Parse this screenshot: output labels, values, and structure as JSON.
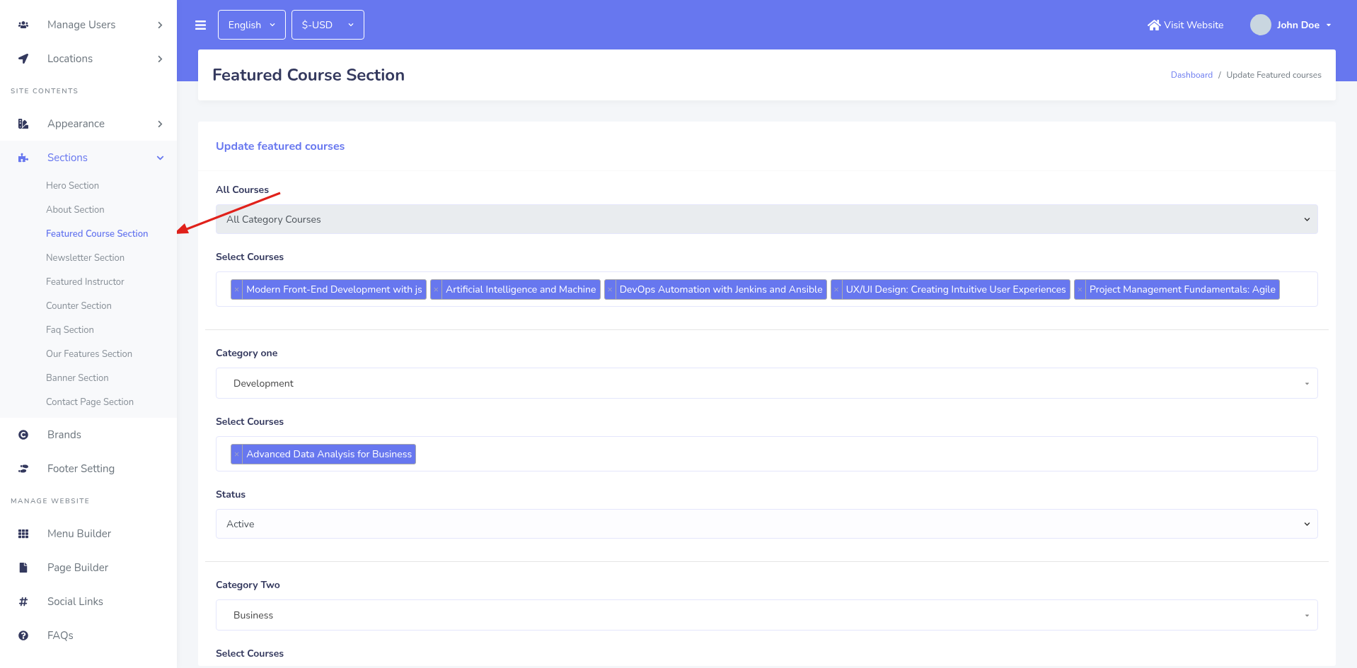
{
  "sidebar": {
    "items": [
      {
        "kind": "item",
        "label": "Manage Users",
        "expanded": false,
        "selected": false
      },
      {
        "kind": "item",
        "label": "Locations",
        "expanded": false,
        "selected": false
      },
      {
        "kind": "heading",
        "label": "SITE CONTENTS"
      },
      {
        "kind": "item",
        "label": "Appearance",
        "expanded": false,
        "selected": false
      },
      {
        "kind": "item",
        "label": "Sections",
        "expanded": true,
        "selected": true,
        "children": [
          {
            "label": "Hero Section",
            "selected": false
          },
          {
            "label": "About Section",
            "selected": false
          },
          {
            "label": "Featured Course Section",
            "selected": true
          },
          {
            "label": "Newsletter Section",
            "selected": false
          },
          {
            "label": "Featured Instructor",
            "selected": false
          },
          {
            "label": "Counter Section",
            "selected": false
          },
          {
            "label": "Faq Section",
            "selected": false
          },
          {
            "label": "Our Features Section",
            "selected": false
          },
          {
            "label": "Banner Section",
            "selected": false
          },
          {
            "label": "Contact Page Section",
            "selected": false
          }
        ]
      },
      {
        "kind": "item",
        "label": "Brands",
        "selected": false
      },
      {
        "kind": "item",
        "label": "Footer Setting",
        "selected": false
      },
      {
        "kind": "heading",
        "label": "MANAGE WEBSITE"
      },
      {
        "kind": "item",
        "label": "Menu Builder",
        "selected": false
      },
      {
        "kind": "item",
        "label": "Page Builder",
        "selected": false
      },
      {
        "kind": "item",
        "label": "Social Links",
        "selected": false
      },
      {
        "kind": "item",
        "label": "FAQs",
        "selected": false
      }
    ]
  },
  "topbar": {
    "language": "English",
    "currency": "$-USD",
    "visit_link": "Visit Website",
    "user": "John Doe"
  },
  "header": {
    "title": "Featured Course Section",
    "breadcrumb": [
      {
        "label": "Dashboard"
      },
      {
        "separator": "/",
        "label": "Update Featured courses"
      }
    ]
  },
  "form": {
    "title": "Update featured courses",
    "groups": [
      [
        {
          "kind": "select",
          "label": "All Courses",
          "value": "All Category Courses",
          "disabled": true
        },
        {
          "kind": "tags",
          "label": "Select Courses",
          "tags": [
            {
              "remove": "×",
              "label": "Modern Front-End Development with js"
            },
            {
              "remove": "×",
              "label": "Artificial Intelligence and Machine"
            },
            {
              "remove": "×",
              "label": "DevOps Automation with Jenkins and Ansible"
            },
            {
              "remove": "×",
              "label": "UX/UI Design: Creating Intuitive User Experiences"
            },
            {
              "remove": "×",
              "label": "Project Management Fundamentals: Agile"
            }
          ]
        }
      ],
      [
        {
          "kind": "dropdown",
          "label": "Category one",
          "value": "Development"
        },
        {
          "kind": "tags",
          "label": "Select Courses",
          "tags": [
            {
              "remove": "×",
              "label": "Advanced Data Analysis for Business"
            }
          ]
        },
        {
          "kind": "select",
          "label": "Status",
          "value": "Active",
          "disabled": false
        }
      ],
      [
        {
          "kind": "dropdown",
          "label": "Category Two",
          "value": "Business"
        },
        {
          "kind": "label",
          "label": "Select Courses"
        }
      ]
    ]
  }
}
